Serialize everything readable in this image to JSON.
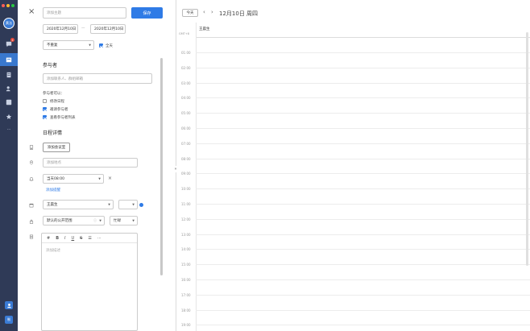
{
  "sidebar": {
    "avatar_text": "黄法",
    "badge_count": "3",
    "bottom_label": "制",
    "more_glyph": "···"
  },
  "form": {
    "title_placeholder": "添加主题",
    "save_label": "保存",
    "start_date": "2020年12月10日",
    "dash": "—",
    "end_date": "2020年12月10日",
    "repeat_value": "不重复",
    "allday_label": "全天",
    "participants_title": "参与者",
    "participants_placeholder": "添加联系人、群组邮箱",
    "permissions_title": "参与者可以：",
    "perm_modify": "修改日程",
    "perm_invite": "邀请参与者",
    "perm_view": "查看参与者列表",
    "details_title": "日程详情",
    "add_meeting_room": "添加会议室",
    "location_placeholder": "添加地点",
    "reminder_value": "当天08:00",
    "add_reminder": "添加提醒",
    "calendar_value": "王晨生",
    "visibility_value": "默认的公开范围",
    "busy_value": "忙碌",
    "description_placeholder": "添加描述",
    "editor_tools": [
      "#",
      "B",
      "I",
      "U",
      "S",
      "☰",
      "⋯"
    ],
    "collapse_glyph": "»"
  },
  "calendar": {
    "today_label": "今天",
    "prev_glyph": "‹",
    "next_glyph": "›",
    "title": "12月10日 周四",
    "timezone": "GMT+8",
    "allday_owner": "王晨生",
    "hours": [
      "01:00",
      "02:00",
      "03:00",
      "04:00",
      "05:00",
      "06:00",
      "07:00",
      "08:00",
      "09:00",
      "10:00",
      "11:00",
      "12:00",
      "13:00",
      "14:00",
      "15:00",
      "16:00",
      "17:00",
      "18:00",
      "19:00"
    ]
  },
  "colors": {
    "accent": "#2f7be6",
    "sidebar_bg": "#2f3a57",
    "badge": "#e74c3c"
  }
}
